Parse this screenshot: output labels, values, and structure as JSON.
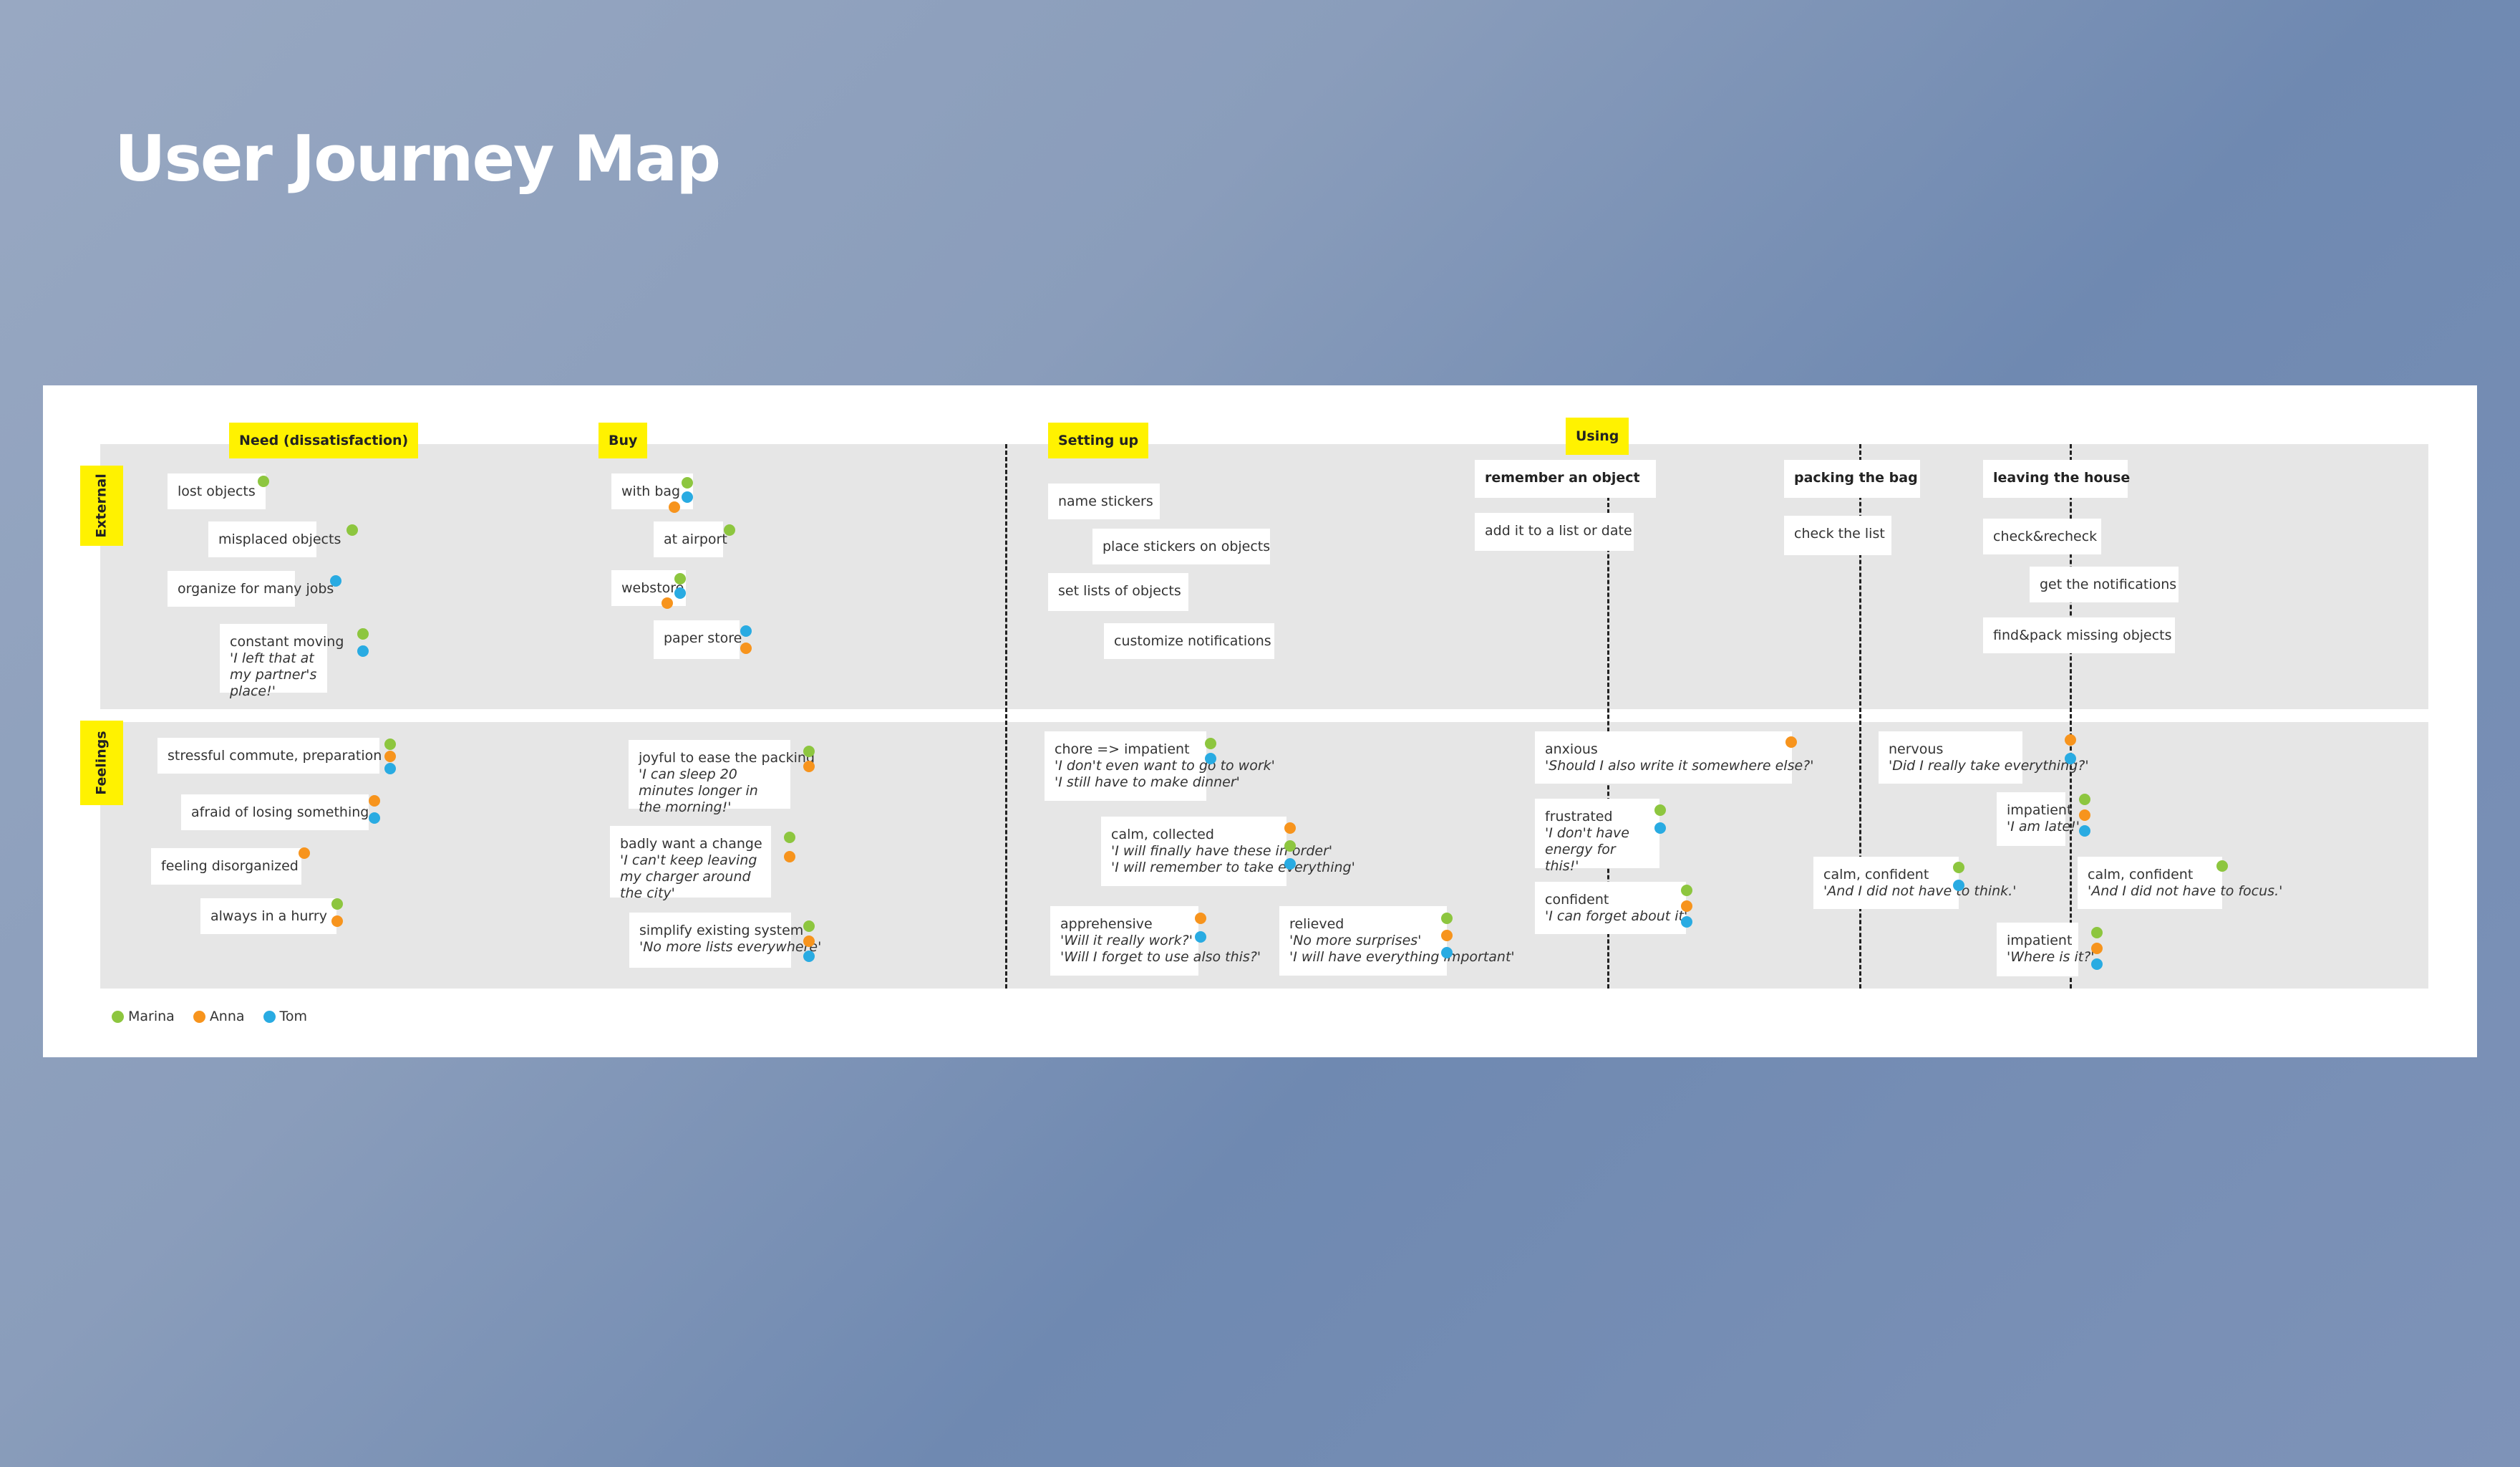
{
  "title": "User Journey Map",
  "colors": {
    "marina": "#8dc63f",
    "anna": "#f7941d",
    "tom": "#29abe2",
    "stage_label": "#fff200",
    "lane_bg": "#e6e6e6"
  },
  "legend": [
    {
      "name": "Marina",
      "color_key": "marina"
    },
    {
      "name": "Anna",
      "color_key": "anna"
    },
    {
      "name": "Tom",
      "color_key": "tom"
    }
  ],
  "lanes": {
    "external": "External",
    "feelings": "Feelings"
  },
  "stages": {
    "need": "Need (dissatisfaction)",
    "buy": "Buy",
    "setting_up": "Setting up",
    "using": "Using"
  },
  "external": {
    "need": [
      {
        "text": "lost objects",
        "people": [
          "marina"
        ]
      },
      {
        "text": "misplaced objects",
        "people": [
          "marina"
        ]
      },
      {
        "text": "organize for many jobs",
        "people": [
          "tom"
        ]
      },
      {
        "text": "constant moving",
        "quote": "'I left that at my partner's place!'",
        "people": [
          "marina",
          "tom"
        ]
      }
    ],
    "buy": [
      {
        "text": "with bag",
        "people": [
          "marina",
          "tom",
          "anna"
        ]
      },
      {
        "text": "at airport",
        "people": [
          "marina"
        ]
      },
      {
        "text": "webstore",
        "people": [
          "marina",
          "tom",
          "anna"
        ]
      },
      {
        "text": "paper store",
        "people": [
          "tom",
          "anna"
        ]
      }
    ],
    "setting_up": [
      {
        "text": "name stickers"
      },
      {
        "text": "place stickers on objects"
      },
      {
        "text": "set lists of objects"
      },
      {
        "text": "customize notifications"
      }
    ],
    "using": {
      "remember": {
        "title": "remember an object",
        "steps": [
          "add it to a list or date"
        ]
      },
      "packing": {
        "title": "packing the bag",
        "steps": [
          "check the list"
        ]
      },
      "leaving": {
        "title": "leaving the house",
        "steps": [
          "check&recheck",
          "get the notifications",
          "find&pack missing objects"
        ]
      }
    }
  },
  "feelings": {
    "need": [
      {
        "text": "stressful commute, preparation",
        "people": [
          "marina",
          "anna",
          "tom"
        ]
      },
      {
        "text": "afraid of losing something",
        "people": [
          "anna",
          "tom"
        ]
      },
      {
        "text": "feeling disorganized",
        "people": [
          "anna"
        ]
      },
      {
        "text": "always in a hurry",
        "people": [
          "marina",
          "anna"
        ]
      }
    ],
    "buy": [
      {
        "text": "joyful to ease the packing",
        "quote": "'I can sleep 20 minutes longer in the morning!'",
        "people": [
          "marina",
          "anna"
        ]
      },
      {
        "text": "badly want a change",
        "quote": "'I can't keep leaving my charger around the city'",
        "people": [
          "marina",
          "anna"
        ]
      },
      {
        "text": "simplify existing system",
        "quote": "'No more lists everywhere'",
        "people": [
          "marina",
          "anna",
          "tom"
        ]
      }
    ],
    "setting_up": [
      {
        "text": "chore => impatient",
        "quote": "'I don't even want to go to work'",
        "quote2": "'I still have to make dinner'",
        "people": [
          "marina",
          "tom"
        ]
      },
      {
        "text": "calm, collected",
        "quote": "'I will finally have these in order'",
        "quote2": "'I will remember to take everything'",
        "people": [
          "anna",
          "marina",
          "tom"
        ]
      },
      {
        "text": "apprehensive",
        "quote": "'Will it really work?'",
        "quote2": "'Will I forget to use also this?'",
        "people": [
          "anna",
          "tom"
        ]
      },
      {
        "text": "relieved",
        "quote": "'No more surprises'",
        "quote2": "'I will have everything important'",
        "people": [
          "marina",
          "anna",
          "tom"
        ]
      }
    ],
    "using": [
      {
        "text": "anxious",
        "quote": "'Should I also write it somewhere else?'",
        "people": [
          "anna"
        ]
      },
      {
        "text": "frustrated",
        "quote": "'I don't have energy for this!'",
        "people": [
          "marina",
          "tom"
        ]
      },
      {
        "text": "confident",
        "quote": "'I can forget about it'",
        "people": [
          "marina",
          "anna",
          "tom"
        ]
      },
      {
        "text": "calm, confident",
        "quote": "'And I did not have to think.'",
        "people": [
          "marina",
          "tom"
        ]
      },
      {
        "text": "nervous",
        "quote": "'Did I really take everything?'",
        "people": [
          "anna",
          "tom"
        ]
      },
      {
        "text": "impatient",
        "quote": "'I am late!'",
        "people": [
          "marina",
          "anna",
          "tom"
        ]
      },
      {
        "text": "calm, confident",
        "quote": "'And I did not have to focus.'",
        "people": [
          "marina"
        ]
      },
      {
        "text": "impatient",
        "quote": "'Where is it?'",
        "people": [
          "marina",
          "anna",
          "tom"
        ]
      }
    ]
  }
}
